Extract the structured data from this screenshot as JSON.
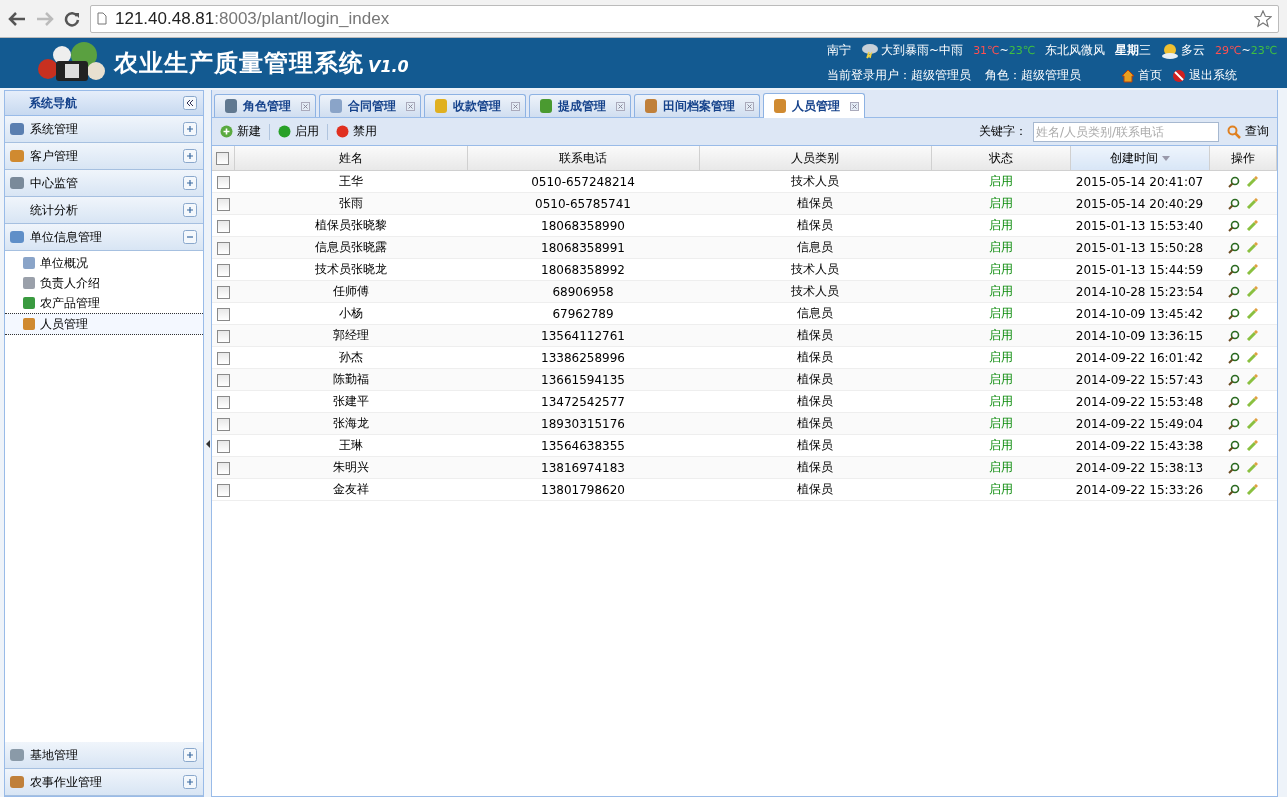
{
  "browser": {
    "host": "121.40.48.81",
    "path": ":8003/plant/login_index"
  },
  "header": {
    "title": "农业生产质量管理系统",
    "version": "V1.0",
    "weather": [
      {
        "city": "南宁",
        "desc": "大到暴雨~中雨",
        "high": "31℃",
        "sep": "~",
        "low": "23℃",
        "wind": "东北风微风",
        "weekday": "**星期**三"
      },
      {
        "desc": "多云",
        "high": "29℃",
        "sep": "~",
        "low": "23℃"
      }
    ],
    "user": "当前登录用户：超级管理员",
    "role": "角色：超级管理员",
    "links": [
      {
        "label": "首页"
      },
      {
        "label": "退出系统"
      }
    ]
  },
  "sidebar": {
    "title": "系统导航",
    "groups": [
      {
        "label": "系统管理",
        "expanded": false
      },
      {
        "label": "客户管理",
        "expanded": false
      },
      {
        "label": "中心监管",
        "expanded": false
      },
      {
        "label": "统计分析",
        "expanded": false
      },
      {
        "label": "单位信息管理",
        "expanded": true,
        "children": [
          {
            "label": "单位概况",
            "selected": false
          },
          {
            "label": "负责人介绍",
            "selected": false
          },
          {
            "label": "农产品管理",
            "selected": false
          },
          {
            "label": "人员管理",
            "selected": true
          }
        ]
      },
      {
        "label": "基地管理",
        "expanded": false
      },
      {
        "label": "农事作业管理",
        "expanded": false
      }
    ]
  },
  "tabs": [
    {
      "label": "角色管理",
      "selected": false
    },
    {
      "label": "合同管理",
      "selected": false
    },
    {
      "label": "收款管理",
      "selected": false
    },
    {
      "label": "提成管理",
      "selected": false
    },
    {
      "label": "田间档案管理",
      "selected": false
    },
    {
      "label": "人员管理",
      "selected": true
    }
  ],
  "toolbar": [
    {
      "label": "新建",
      "kind": "add"
    },
    {
      "label": "启用",
      "kind": "enable"
    },
    {
      "label": "禁用",
      "kind": "disable"
    }
  ],
  "search": {
    "label": "关键字：",
    "placeholder": "姓名/人员类别/联系电话",
    "button": "查询"
  },
  "table": {
    "all_checked": false,
    "columns": [
      {
        "label": "姓名",
        "sorted": false
      },
      {
        "label": "联系电话",
        "sorted": false
      },
      {
        "label": "人员类别",
        "sorted": false
      },
      {
        "label": "状态",
        "sorted": false
      },
      {
        "label": "创建时间",
        "sorted": true
      },
      {
        "label": "操作",
        "sorted": false
      }
    ],
    "rows": [
      {
        "checked": false,
        "name": "王华",
        "phone": "0510-657248214",
        "type": "技术人员",
        "status": "启用",
        "created": "2015-05-14 20:41:07"
      },
      {
        "checked": false,
        "name": "张雨",
        "phone": "0510-65785741",
        "type": "植保员",
        "status": "启用",
        "created": "2015-05-14 20:40:29"
      },
      {
        "checked": false,
        "name": "植保员张晓黎",
        "phone": "18068358990",
        "type": "植保员",
        "status": "启用",
        "created": "2015-01-13 15:53:40"
      },
      {
        "checked": false,
        "name": "信息员张晓露",
        "phone": "18068358991",
        "type": "信息员",
        "status": "启用",
        "created": "2015-01-13 15:50:28"
      },
      {
        "checked": false,
        "name": "技术员张晓龙",
        "phone": "18068358992",
        "type": "技术人员",
        "status": "启用",
        "created": "2015-01-13 15:44:59"
      },
      {
        "checked": false,
        "name": "任师傅",
        "phone": "68906958",
        "type": "技术人员",
        "status": "启用",
        "created": "2014-10-28 15:23:54"
      },
      {
        "checked": false,
        "name": "小杨",
        "phone": "67962789",
        "type": "信息员",
        "status": "启用",
        "created": "2014-10-09 13:45:42"
      },
      {
        "checked": false,
        "name": "郭经理",
        "phone": "13564112761",
        "type": "植保员",
        "status": "启用",
        "created": "2014-10-09 13:36:15"
      },
      {
        "checked": false,
        "name": "孙杰",
        "phone": "13386258996",
        "type": "植保员",
        "status": "启用",
        "created": "2014-09-22 16:01:42"
      },
      {
        "checked": false,
        "name": "陈勤福",
        "phone": "13661594135",
        "type": "植保员",
        "status": "启用",
        "created": "2014-09-22 15:57:43"
      },
      {
        "checked": false,
        "name": "张建平",
        "phone": "13472542577",
        "type": "植保员",
        "status": "启用",
        "created": "2014-09-22 15:53:48"
      },
      {
        "checked": false,
        "name": "张海龙",
        "phone": "18930315176",
        "type": "植保员",
        "status": "启用",
        "created": "2014-09-22 15:49:04"
      },
      {
        "checked": false,
        "name": "王琳",
        "phone": "13564638355",
        "type": "植保员",
        "status": "启用",
        "created": "2014-09-22 15:43:38"
      },
      {
        "checked": false,
        "name": "朱明兴",
        "phone": "13816974183",
        "type": "植保员",
        "status": "启用",
        "created": "2014-09-22 15:38:13"
      },
      {
        "checked": false,
        "name": "金友祥",
        "phone": "13801798620",
        "type": "植保员",
        "status": "启用",
        "created": "2014-09-22 15:33:26"
      }
    ]
  }
}
